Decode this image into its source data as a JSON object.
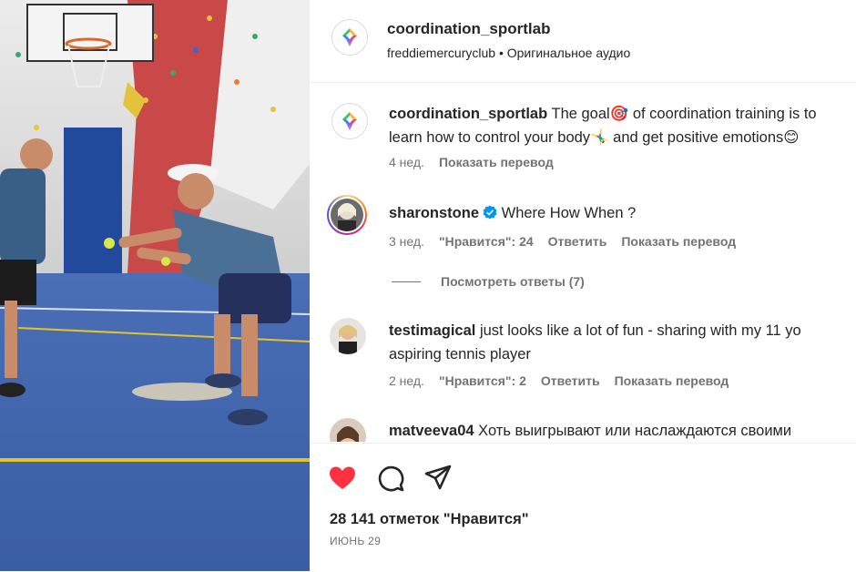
{
  "post": {
    "author": "coordination_sportlab",
    "audio_line": "freddiemercuryclub • Оригинальное аудио"
  },
  "comments": [
    {
      "username": "coordination_sportlab",
      "text": "The goal🎯 of coordination training is to learn how to control your body🤸‍♂️ and get positive emotions😊",
      "age": "4 нед.",
      "show_translation": "Показать перевод"
    },
    {
      "username": "sharonstone",
      "verified": true,
      "text": "Where How When ?",
      "age": "3 нед.",
      "likes": "\"Нравится\": 24",
      "reply": "Ответить",
      "show_translation": "Показать перевод",
      "view_replies": "Посмотреть ответы (7)"
    },
    {
      "username": "testimagical",
      "text": "just looks like a lot of fun - sharing with my 11 yo aspiring tennis player",
      "age": "2 нед.",
      "likes": "\"Нравится\": 2",
      "reply": "Ответить",
      "show_translation": "Показать перевод"
    },
    {
      "username": "matveeva04",
      "text": "Хоть выигрывают или наслаждаются своими"
    }
  ],
  "footer": {
    "likes_count": "28 141 отметок \"Нравится\"",
    "date": "ИЮНЬ 29"
  },
  "icons": {
    "like": "heart-filled-icon",
    "comment": "comment-bubble-icon",
    "share": "paper-plane-icon"
  },
  "colors": {
    "like_red": "#ff3040",
    "verified_blue": "#0095f6",
    "court_blue": "#3c63ad"
  }
}
